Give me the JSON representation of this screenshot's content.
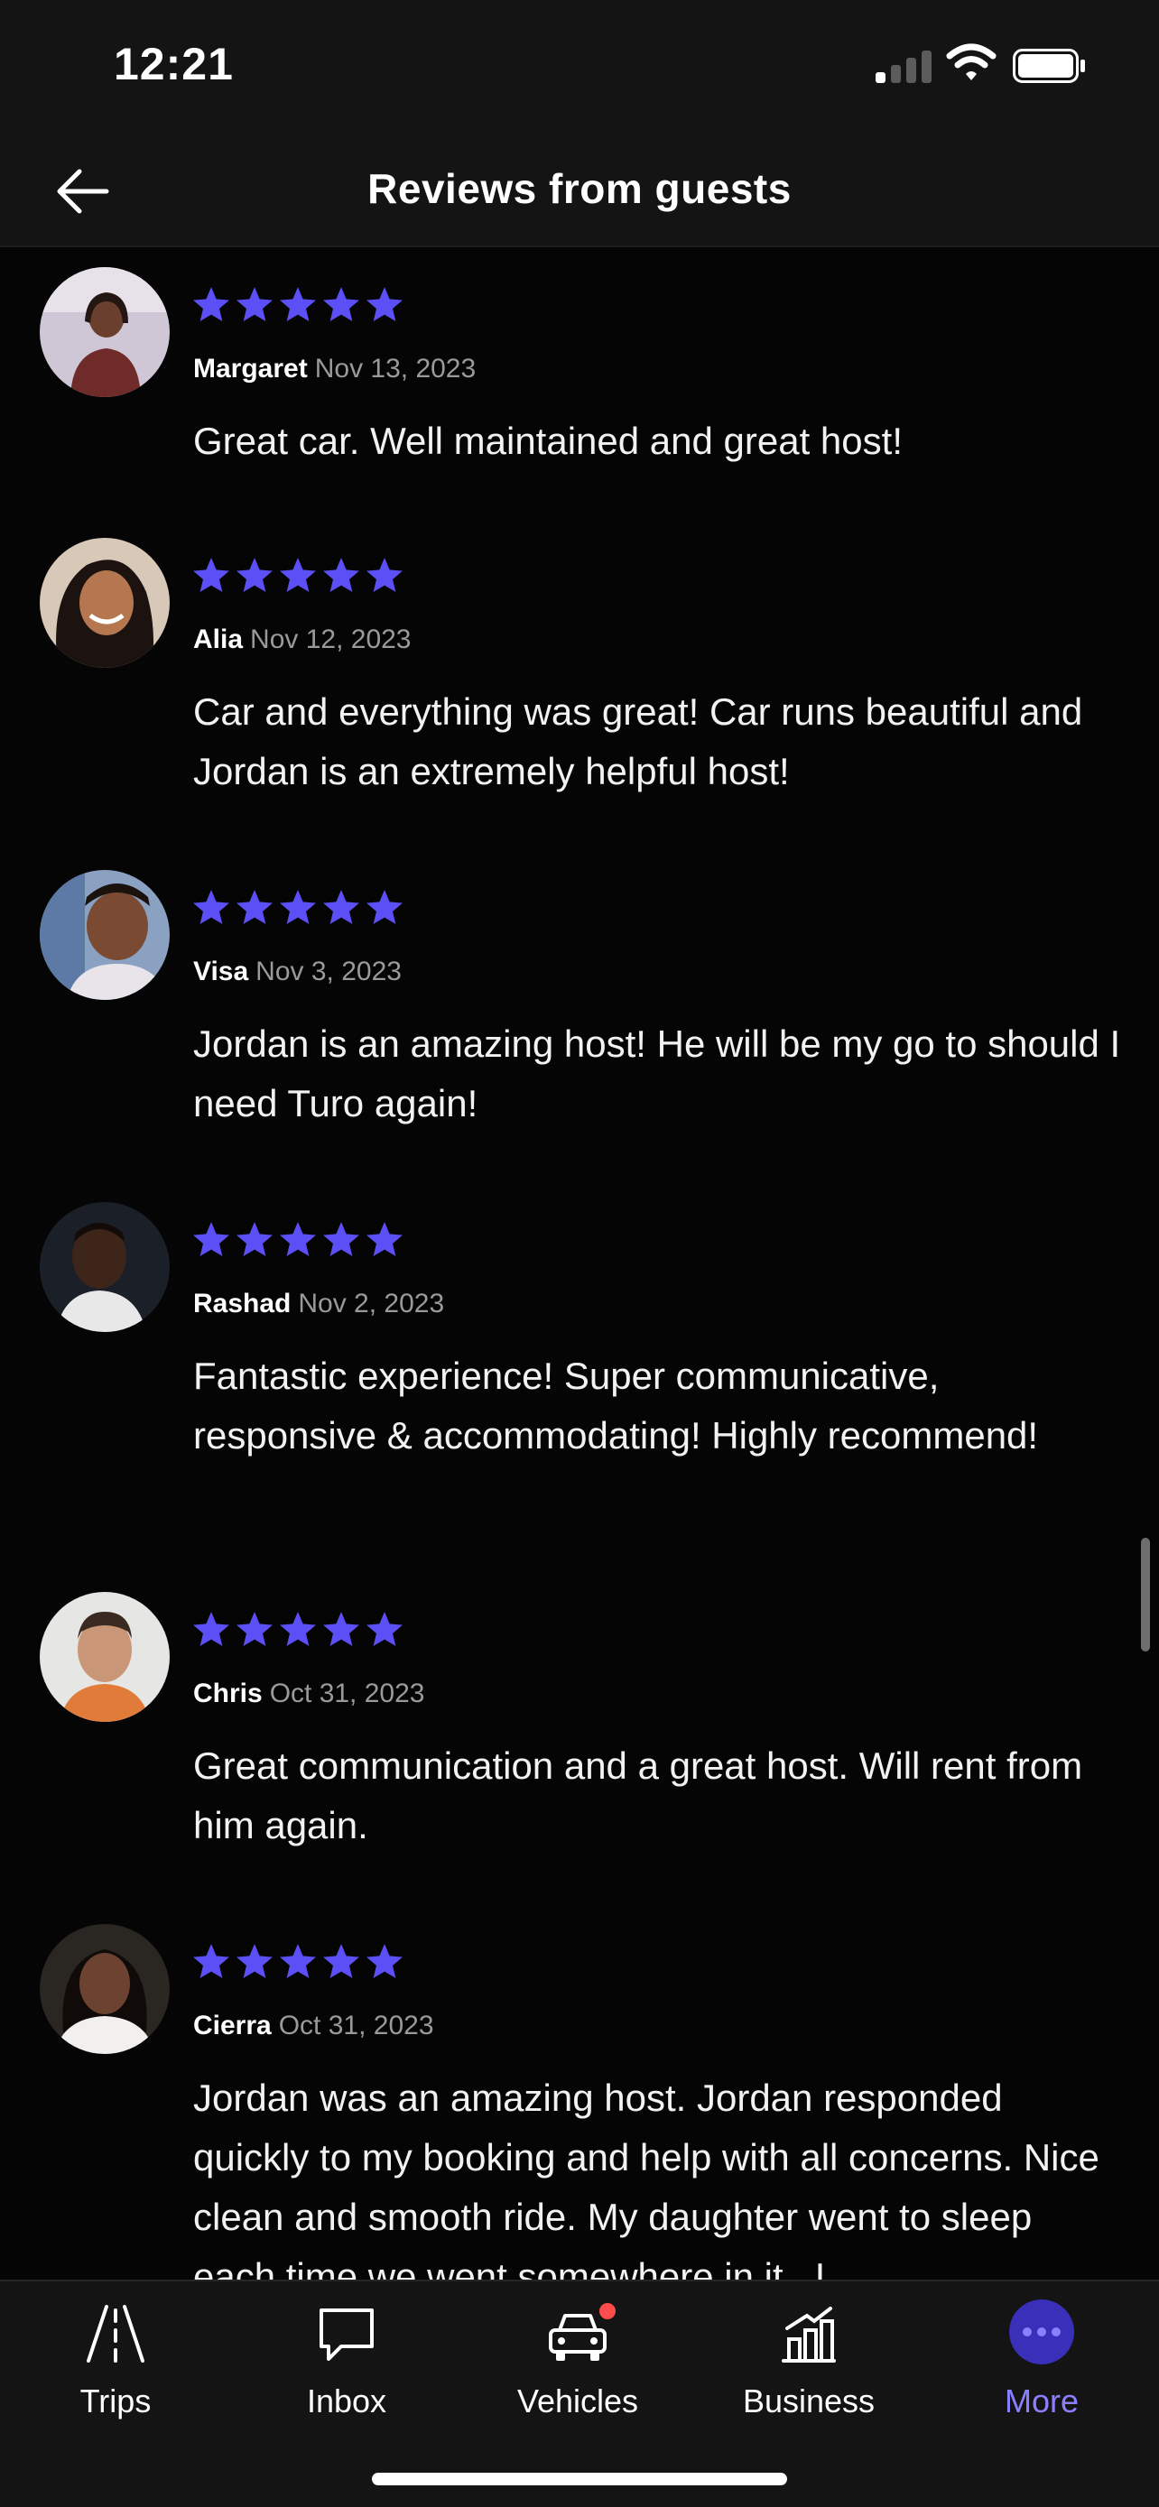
{
  "status_bar": {
    "time": "12:21"
  },
  "header": {
    "title": "Reviews from guests"
  },
  "reviews": [
    {
      "name": "Margaret",
      "date": "Nov 13, 2023",
      "rating": 5,
      "text": "Great car. Well maintained and great host!"
    },
    {
      "name": "Alia",
      "date": "Nov 12, 2023",
      "rating": 5,
      "text": "Car and everything was great! Car runs beautiful and Jordan is an extremely helpful host!"
    },
    {
      "name": "Visa",
      "date": "Nov 3, 2023",
      "rating": 5,
      "text": "Jordan is an amazing host! He will be my go to should I need Turo again!"
    },
    {
      "name": "Rashad",
      "date": "Nov 2, 2023",
      "rating": 5,
      "text": "Fantastic experience! Super communicative, responsive & accommodating! Highly recommend!"
    },
    {
      "name": "Chris",
      "date": "Oct 31, 2023",
      "rating": 5,
      "text": "Great communication and a great host. Will rent from him again."
    },
    {
      "name": "Cierra",
      "date": "Oct 31, 2023",
      "rating": 5,
      "text": "Jordan was an amazing host. Jordan responded quickly to my booking and help with all concerns. Nice clean and smooth ride. My daughter went to sleep each time we went somewhere in it , I"
    }
  ],
  "tab_bar": {
    "tabs": [
      {
        "label": "Trips",
        "icon": "road-icon"
      },
      {
        "label": "Inbox",
        "icon": "chat-bubble-icon"
      },
      {
        "label": "Vehicles",
        "icon": "car-icon"
      },
      {
        "label": "Business",
        "icon": "bar-chart-icon"
      },
      {
        "label": "More",
        "icon": "more-dots-icon"
      }
    ],
    "active": "More"
  },
  "colors": {
    "background": "#050505",
    "bar_background": "#141414",
    "star": "#5b4ff5",
    "accent": "#8a80ff",
    "muted_text": "#9a9a9a",
    "notification_dot": "#ff4d4d"
  }
}
